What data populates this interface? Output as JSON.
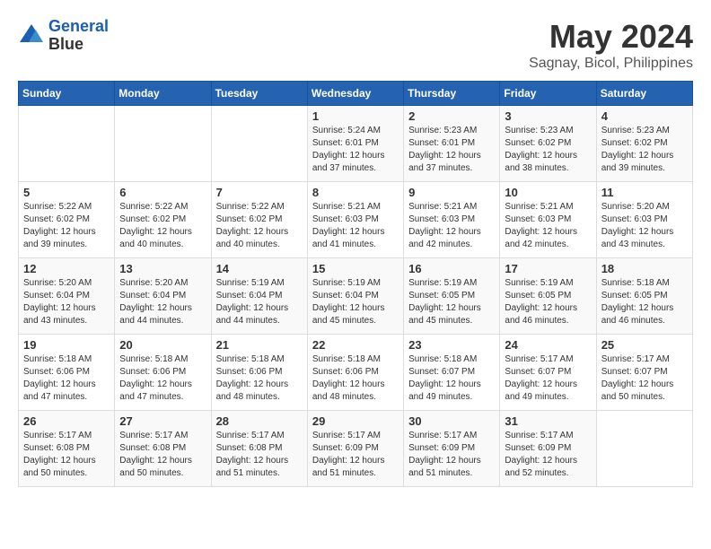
{
  "header": {
    "logo_line1": "General",
    "logo_line2": "Blue",
    "month": "May 2024",
    "location": "Sagnay, Bicol, Philippines"
  },
  "weekdays": [
    "Sunday",
    "Monday",
    "Tuesday",
    "Wednesday",
    "Thursday",
    "Friday",
    "Saturday"
  ],
  "weeks": [
    [
      {
        "day": "",
        "sunrise": "",
        "sunset": "",
        "daylight": ""
      },
      {
        "day": "",
        "sunrise": "",
        "sunset": "",
        "daylight": ""
      },
      {
        "day": "",
        "sunrise": "",
        "sunset": "",
        "daylight": ""
      },
      {
        "day": "1",
        "sunrise": "Sunrise: 5:24 AM",
        "sunset": "Sunset: 6:01 PM",
        "daylight": "Daylight: 12 hours and 37 minutes."
      },
      {
        "day": "2",
        "sunrise": "Sunrise: 5:23 AM",
        "sunset": "Sunset: 6:01 PM",
        "daylight": "Daylight: 12 hours and 37 minutes."
      },
      {
        "day": "3",
        "sunrise": "Sunrise: 5:23 AM",
        "sunset": "Sunset: 6:02 PM",
        "daylight": "Daylight: 12 hours and 38 minutes."
      },
      {
        "day": "4",
        "sunrise": "Sunrise: 5:23 AM",
        "sunset": "Sunset: 6:02 PM",
        "daylight": "Daylight: 12 hours and 39 minutes."
      }
    ],
    [
      {
        "day": "5",
        "sunrise": "Sunrise: 5:22 AM",
        "sunset": "Sunset: 6:02 PM",
        "daylight": "Daylight: 12 hours and 39 minutes."
      },
      {
        "day": "6",
        "sunrise": "Sunrise: 5:22 AM",
        "sunset": "Sunset: 6:02 PM",
        "daylight": "Daylight: 12 hours and 40 minutes."
      },
      {
        "day": "7",
        "sunrise": "Sunrise: 5:22 AM",
        "sunset": "Sunset: 6:02 PM",
        "daylight": "Daylight: 12 hours and 40 minutes."
      },
      {
        "day": "8",
        "sunrise": "Sunrise: 5:21 AM",
        "sunset": "Sunset: 6:03 PM",
        "daylight": "Daylight: 12 hours and 41 minutes."
      },
      {
        "day": "9",
        "sunrise": "Sunrise: 5:21 AM",
        "sunset": "Sunset: 6:03 PM",
        "daylight": "Daylight: 12 hours and 42 minutes."
      },
      {
        "day": "10",
        "sunrise": "Sunrise: 5:21 AM",
        "sunset": "Sunset: 6:03 PM",
        "daylight": "Daylight: 12 hours and 42 minutes."
      },
      {
        "day": "11",
        "sunrise": "Sunrise: 5:20 AM",
        "sunset": "Sunset: 6:03 PM",
        "daylight": "Daylight: 12 hours and 43 minutes."
      }
    ],
    [
      {
        "day": "12",
        "sunrise": "Sunrise: 5:20 AM",
        "sunset": "Sunset: 6:04 PM",
        "daylight": "Daylight: 12 hours and 43 minutes."
      },
      {
        "day": "13",
        "sunrise": "Sunrise: 5:20 AM",
        "sunset": "Sunset: 6:04 PM",
        "daylight": "Daylight: 12 hours and 44 minutes."
      },
      {
        "day": "14",
        "sunrise": "Sunrise: 5:19 AM",
        "sunset": "Sunset: 6:04 PM",
        "daylight": "Daylight: 12 hours and 44 minutes."
      },
      {
        "day": "15",
        "sunrise": "Sunrise: 5:19 AM",
        "sunset": "Sunset: 6:04 PM",
        "daylight": "Daylight: 12 hours and 45 minutes."
      },
      {
        "day": "16",
        "sunrise": "Sunrise: 5:19 AM",
        "sunset": "Sunset: 6:05 PM",
        "daylight": "Daylight: 12 hours and 45 minutes."
      },
      {
        "day": "17",
        "sunrise": "Sunrise: 5:19 AM",
        "sunset": "Sunset: 6:05 PM",
        "daylight": "Daylight: 12 hours and 46 minutes."
      },
      {
        "day": "18",
        "sunrise": "Sunrise: 5:18 AM",
        "sunset": "Sunset: 6:05 PM",
        "daylight": "Daylight: 12 hours and 46 minutes."
      }
    ],
    [
      {
        "day": "19",
        "sunrise": "Sunrise: 5:18 AM",
        "sunset": "Sunset: 6:06 PM",
        "daylight": "Daylight: 12 hours and 47 minutes."
      },
      {
        "day": "20",
        "sunrise": "Sunrise: 5:18 AM",
        "sunset": "Sunset: 6:06 PM",
        "daylight": "Daylight: 12 hours and 47 minutes."
      },
      {
        "day": "21",
        "sunrise": "Sunrise: 5:18 AM",
        "sunset": "Sunset: 6:06 PM",
        "daylight": "Daylight: 12 hours and 48 minutes."
      },
      {
        "day": "22",
        "sunrise": "Sunrise: 5:18 AM",
        "sunset": "Sunset: 6:06 PM",
        "daylight": "Daylight: 12 hours and 48 minutes."
      },
      {
        "day": "23",
        "sunrise": "Sunrise: 5:18 AM",
        "sunset": "Sunset: 6:07 PM",
        "daylight": "Daylight: 12 hours and 49 minutes."
      },
      {
        "day": "24",
        "sunrise": "Sunrise: 5:17 AM",
        "sunset": "Sunset: 6:07 PM",
        "daylight": "Daylight: 12 hours and 49 minutes."
      },
      {
        "day": "25",
        "sunrise": "Sunrise: 5:17 AM",
        "sunset": "Sunset: 6:07 PM",
        "daylight": "Daylight: 12 hours and 50 minutes."
      }
    ],
    [
      {
        "day": "26",
        "sunrise": "Sunrise: 5:17 AM",
        "sunset": "Sunset: 6:08 PM",
        "daylight": "Daylight: 12 hours and 50 minutes."
      },
      {
        "day": "27",
        "sunrise": "Sunrise: 5:17 AM",
        "sunset": "Sunset: 6:08 PM",
        "daylight": "Daylight: 12 hours and 50 minutes."
      },
      {
        "day": "28",
        "sunrise": "Sunrise: 5:17 AM",
        "sunset": "Sunset: 6:08 PM",
        "daylight": "Daylight: 12 hours and 51 minutes."
      },
      {
        "day": "29",
        "sunrise": "Sunrise: 5:17 AM",
        "sunset": "Sunset: 6:09 PM",
        "daylight": "Daylight: 12 hours and 51 minutes."
      },
      {
        "day": "30",
        "sunrise": "Sunrise: 5:17 AM",
        "sunset": "Sunset: 6:09 PM",
        "daylight": "Daylight: 12 hours and 51 minutes."
      },
      {
        "day": "31",
        "sunrise": "Sunrise: 5:17 AM",
        "sunset": "Sunset: 6:09 PM",
        "daylight": "Daylight: 12 hours and 52 minutes."
      },
      {
        "day": "",
        "sunrise": "",
        "sunset": "",
        "daylight": ""
      }
    ]
  ]
}
